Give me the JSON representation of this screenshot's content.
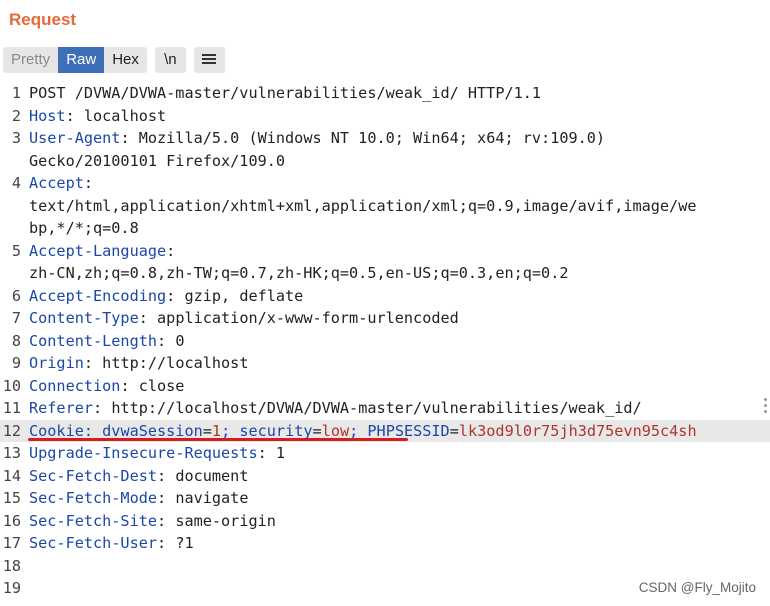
{
  "panel": {
    "title": "Request"
  },
  "toolbar": {
    "pretty_label": "Pretty",
    "raw_label": "Raw",
    "hex_label": "Hex",
    "newline_label": "\\n",
    "menu_icon": "hamburger-menu-icon"
  },
  "request_lines": [
    {
      "n": "1",
      "text": "POST /DVWA/DVWA-master/vulnerabilities/weak_id/ HTTP/1.1"
    },
    {
      "n": "2",
      "key": "Host",
      "value": "localhost"
    },
    {
      "n": "3",
      "key": "User-Agent",
      "value": "Mozilla/5.0 (Windows NT 10.0; Win64; x64; rv:109.0)"
    },
    {
      "n": "",
      "text": "Gecko/20100101 Firefox/109.0"
    },
    {
      "n": "4",
      "key": "Accept",
      "value": ""
    },
    {
      "n": "",
      "text": "text/html,application/xhtml+xml,application/xml;q=0.9,image/avif,image/we"
    },
    {
      "n": "",
      "text": "bp,*/*;q=0.8"
    },
    {
      "n": "5",
      "key": "Accept-Language",
      "value": ""
    },
    {
      "n": "",
      "text": "zh-CN,zh;q=0.8,zh-TW;q=0.7,zh-HK;q=0.5,en-US;q=0.3,en;q=0.2"
    },
    {
      "n": "6",
      "key": "Accept-Encoding",
      "value": "gzip, deflate"
    },
    {
      "n": "7",
      "key": "Content-Type",
      "value": "application/x-www-form-urlencoded"
    },
    {
      "n": "8",
      "key": "Content-Length",
      "value": "0"
    },
    {
      "n": "9",
      "key": "Origin",
      "value": "http://localhost"
    },
    {
      "n": "10",
      "key": "Connection",
      "value": "close"
    },
    {
      "n": "11",
      "key": "Referer",
      "value": "http://localhost/DVWA/DVWA-master/vulnerabilities/weak_id/"
    },
    {
      "n": "12",
      "cookie": true,
      "key": "Cookie",
      "parts": [
        {
          "k": "dvwaSession",
          "v": "1"
        },
        {
          "k": "security",
          "v": "low"
        },
        {
          "k": "PHPSESSID",
          "v": "lk3od9l0r75jh3d75evn95c4sh"
        }
      ]
    },
    {
      "n": "13",
      "key": "Upgrade-Insecure-Requests",
      "value": "1"
    },
    {
      "n": "14",
      "key": "Sec-Fetch-Dest",
      "value": "document"
    },
    {
      "n": "15",
      "key": "Sec-Fetch-Mode",
      "value": "navigate"
    },
    {
      "n": "16",
      "key": "Sec-Fetch-Site",
      "value": "same-origin"
    },
    {
      "n": "17",
      "key": "Sec-Fetch-User",
      "value": "?1"
    },
    {
      "n": "18",
      "text": ""
    },
    {
      "n": "19",
      "text": ""
    }
  ],
  "watermark": "CSDN @Fly_Mojito",
  "colors": {
    "title": "#e8683a",
    "active_tab": "#3d6fb6",
    "header_key": "#1a47a8",
    "cookie_value": "#b0342a",
    "underline": "#d21e1e"
  }
}
